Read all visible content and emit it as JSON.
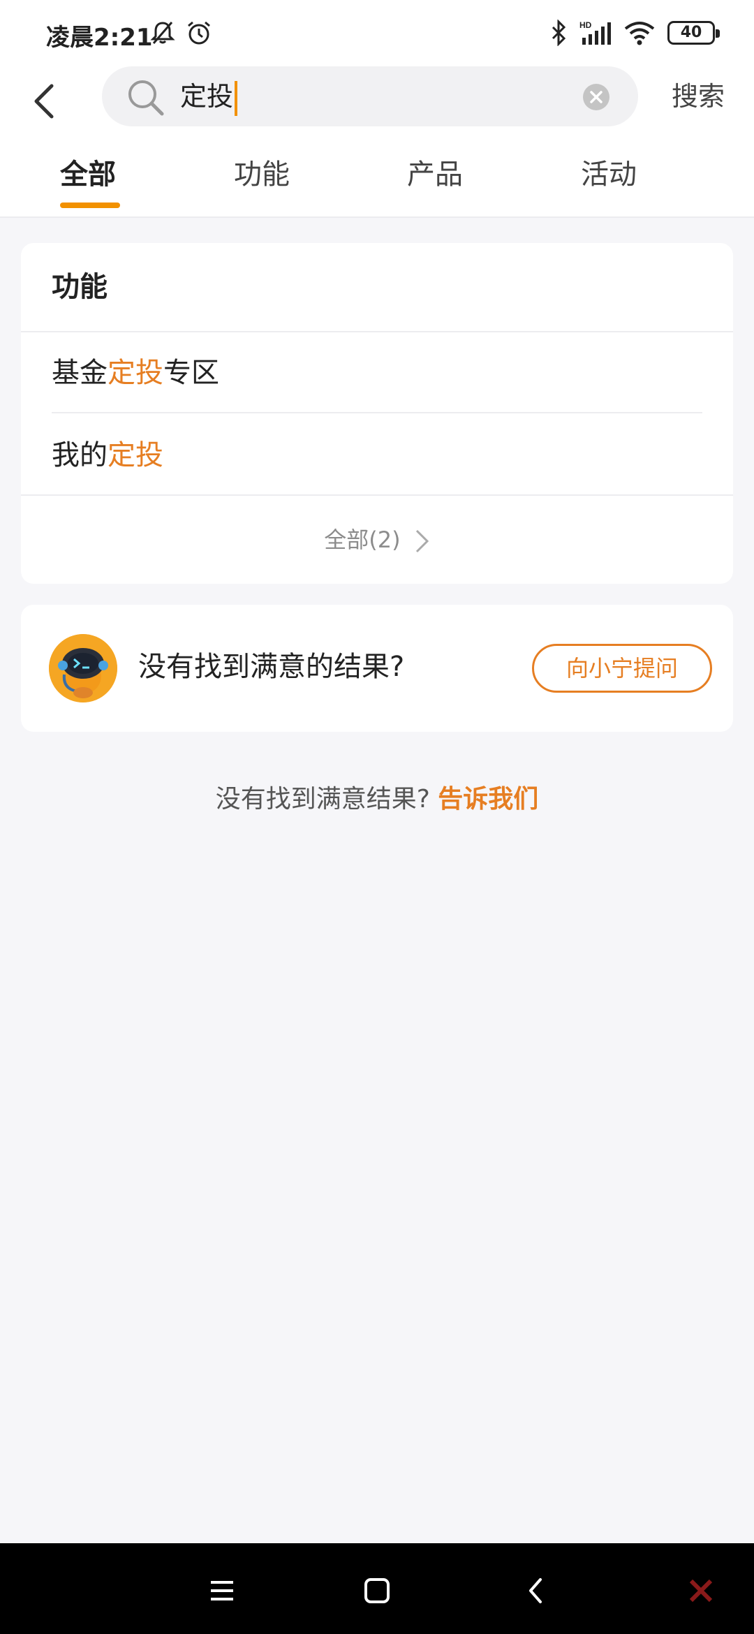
{
  "status_bar": {
    "time": "凌晨2:21",
    "battery": "40",
    "network": "HD"
  },
  "header": {
    "search_value": "定投",
    "search_action": "搜索"
  },
  "tabs": [
    {
      "label": "全部",
      "active": true
    },
    {
      "label": "功能",
      "active": false
    },
    {
      "label": "产品",
      "active": false
    },
    {
      "label": "活动",
      "active": false
    }
  ],
  "function_card": {
    "title": "功能",
    "items": [
      {
        "prefix": "基金",
        "highlight": "定投",
        "suffix": "专区"
      },
      {
        "prefix": "我的",
        "highlight": "定投",
        "suffix": ""
      }
    ],
    "view_all": "全部(2)"
  },
  "ask_card": {
    "text": "没有找到满意的结果?",
    "button": "向小宁提问"
  },
  "feedback": {
    "text": "没有找到满意结果?",
    "link": "告诉我们"
  },
  "colors": {
    "accent": "#f29100",
    "highlight": "#e67e22",
    "background": "#f6f6f9"
  },
  "icons": [
    "back-icon",
    "search-icon",
    "clear-icon",
    "chevron-right-icon",
    "menu-icon",
    "home-icon",
    "nav-back-icon",
    "bell-off-icon",
    "alarm-icon",
    "bluetooth-icon",
    "signal-icon",
    "wifi-icon"
  ]
}
